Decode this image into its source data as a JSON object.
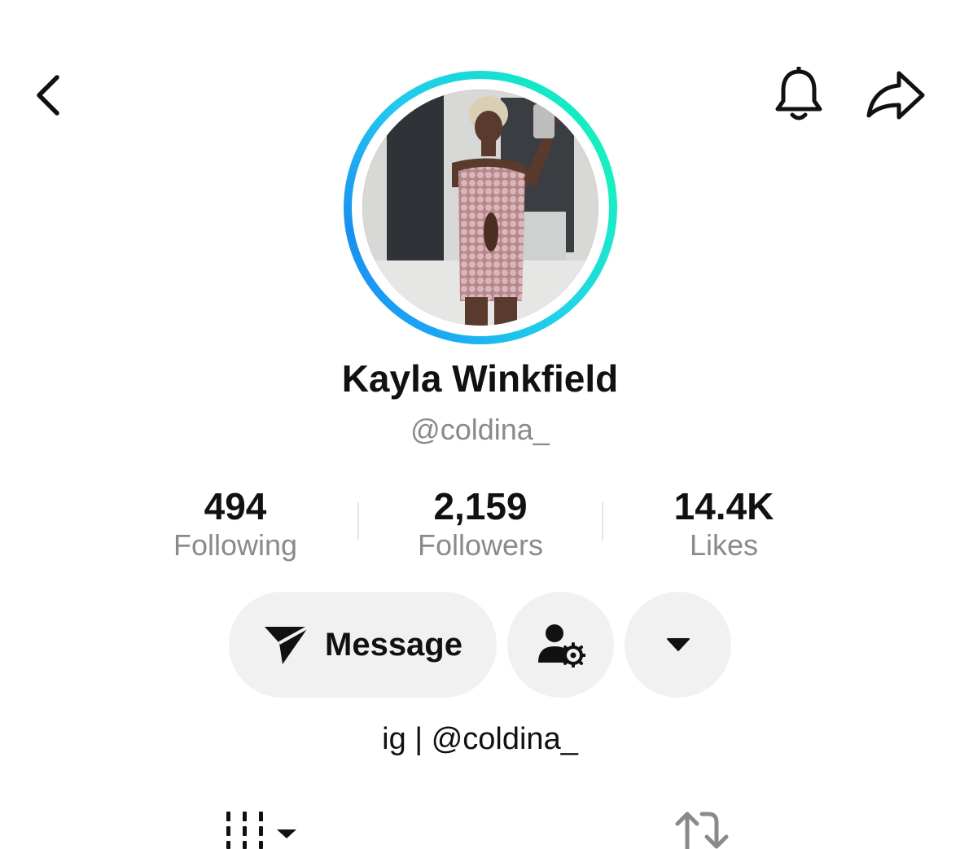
{
  "header": {
    "back_icon": "chevron-left-icon",
    "bell_icon": "bell-icon",
    "share_icon": "share-arrow-icon"
  },
  "profile": {
    "display_name": "Kayla Winkfield",
    "handle": "@coldina_",
    "avatar_ring_colors": [
      "#1aa6f5",
      "#19f0bf"
    ]
  },
  "stats": [
    {
      "value": "494",
      "label": "Following"
    },
    {
      "value": "2,159",
      "label": "Followers"
    },
    {
      "value": "14.4K",
      "label": "Likes"
    }
  ],
  "actions": {
    "message_label": "Message",
    "message_icon": "send-icon",
    "person_settings_icon": "person-settings-icon",
    "more_icon": "caret-down-icon"
  },
  "bio": "ig | @coldina_",
  "tabs": [
    {
      "name": "videos-grid",
      "icon": "grid-icon"
    },
    {
      "name": "reposts",
      "icon": "repost-icon"
    }
  ]
}
